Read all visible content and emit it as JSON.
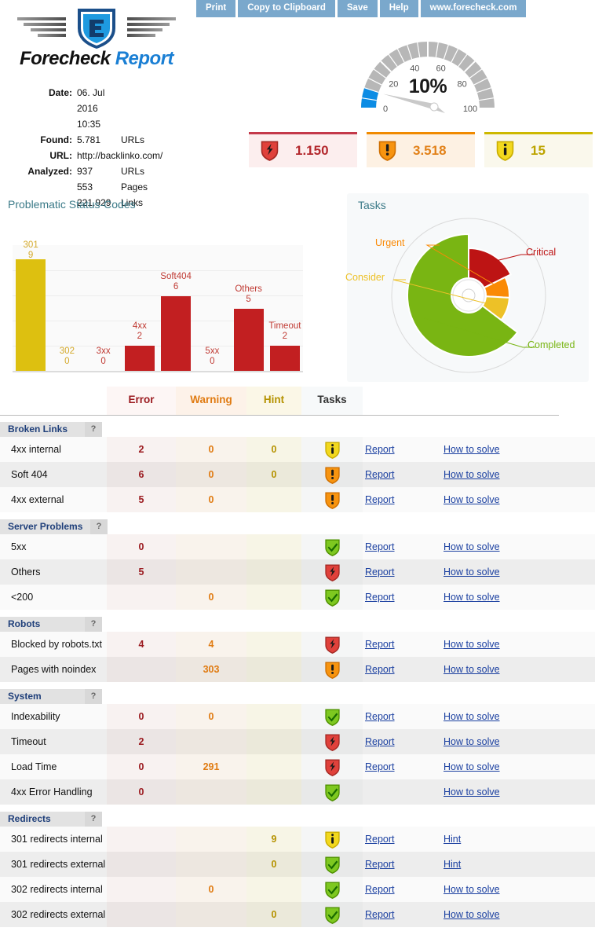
{
  "toolbar": {
    "buttons": [
      {
        "label": "Print",
        "name": "print-button"
      },
      {
        "label": "Copy to Clipboard",
        "name": "copy-to-clipboard-button"
      },
      {
        "label": "Save",
        "name": "save-button"
      },
      {
        "label": "Help",
        "name": "help-button"
      },
      {
        "label": "www.forecheck.com",
        "name": "website-link-button"
      }
    ]
  },
  "logo": {
    "brand": "Forecheck",
    "product": "Report"
  },
  "meta": {
    "rows": [
      {
        "label": "Date:",
        "value": "06. Jul 2016 10:35",
        "unit": ""
      },
      {
        "label": "Found:",
        "value": "5.781",
        "unit": "URLs"
      },
      {
        "label": "URL:",
        "value": "http://backlinko.com/",
        "unit": ""
      },
      {
        "label": "Analyzed:",
        "value": "937",
        "unit": "URLs"
      },
      {
        "label": "",
        "value": "553",
        "unit": "Pages"
      },
      {
        "label": "",
        "value": "221.929",
        "unit": "Links"
      }
    ]
  },
  "gauge": {
    "percent_label": "10%",
    "value": 10,
    "min": 0,
    "max": 100,
    "ticks": [
      "0",
      "20",
      "40",
      "60",
      "80",
      "100"
    ],
    "fill_color": "#0c8ce4",
    "track_color": "#b7b7b7"
  },
  "stats": [
    {
      "name": "critical-stat",
      "value": "1.150",
      "icon": "shield-critical-icon",
      "color": "#b3282d"
    },
    {
      "name": "warning-stat",
      "value": "3.518",
      "icon": "shield-warning-icon",
      "color": "#e2821a"
    },
    {
      "name": "hint-stat",
      "value": "15",
      "icon": "shield-hint-icon",
      "color": "#bda400"
    }
  ],
  "chart_data": [
    {
      "type": "bar",
      "title": "Problematic Status-Codes",
      "categories": [
        "301",
        "302",
        "3xx",
        "4xx",
        "Soft404",
        "5xx",
        "Others",
        "Timeout"
      ],
      "values": [
        9,
        0,
        0,
        2,
        6,
        0,
        5,
        2
      ],
      "colors": [
        "#ddc010",
        "#ddc010",
        "#c21f21",
        "#c21f21",
        "#c21f21",
        "#c21f21",
        "#c21f21",
        "#c21f21"
      ],
      "label_colors": [
        "#d4a92a",
        "#d4a92a",
        "#c03a33",
        "#c03a33",
        "#c03a33",
        "#c03a33",
        "#c03a33",
        "#c03a33"
      ],
      "xlabel": "",
      "ylabel": "",
      "ylim": [
        0,
        9
      ],
      "grid": true,
      "legend": false
    },
    {
      "type": "pie",
      "title": "Tasks",
      "categories": [
        "Critical",
        "Urgent",
        "Consider",
        "Completed"
      ],
      "values": [
        15,
        7,
        8,
        55
      ],
      "colors": [
        "#bd1414",
        "#fa8a05",
        "#edc127",
        "#79b513"
      ],
      "legend": "callout-labels"
    }
  ],
  "table": {
    "columns": [
      "Error",
      "Warning",
      "Hint",
      "Tasks"
    ],
    "help_label": "?",
    "sections": [
      {
        "title": "Broken Links",
        "rows": [
          {
            "name": "4xx internal",
            "error": "2",
            "warning": "0",
            "hint": "0",
            "task_icon": "shield-hint-icon",
            "report": "Report",
            "solve": "How to solve"
          },
          {
            "name": "Soft 404",
            "error": "6",
            "warning": "0",
            "hint": "0",
            "task_icon": "shield-warning-icon",
            "report": "Report",
            "solve": "How to solve"
          },
          {
            "name": "4xx external",
            "error": "5",
            "warning": "0",
            "hint": "",
            "task_icon": "shield-warning-icon",
            "report": "Report",
            "solve": "How to solve"
          }
        ]
      },
      {
        "title": "Server Problems",
        "rows": [
          {
            "name": "5xx",
            "error": "0",
            "warning": "",
            "hint": "",
            "task_icon": "shield-ok-icon",
            "report": "Report",
            "solve": "How to solve"
          },
          {
            "name": "Others",
            "error": "5",
            "warning": "",
            "hint": "",
            "task_icon": "shield-critical-icon",
            "report": "Report",
            "solve": "How to solve"
          },
          {
            "name": "<200",
            "error": "",
            "warning": "0",
            "hint": "",
            "task_icon": "shield-ok-icon",
            "report": "Report",
            "solve": "How to solve"
          }
        ]
      },
      {
        "title": "Robots",
        "rows": [
          {
            "name": "Blocked by robots.txt",
            "error": "4",
            "warning": "4",
            "hint": "",
            "task_icon": "shield-critical-icon",
            "report": "Report",
            "solve": "How to solve"
          },
          {
            "name": "Pages with noindex",
            "error": "",
            "warning": "303",
            "hint": "",
            "task_icon": "shield-warning-icon",
            "report": "Report",
            "solve": "How to solve"
          }
        ]
      },
      {
        "title": "System",
        "rows": [
          {
            "name": "Indexability",
            "error": "0",
            "warning": "0",
            "hint": "",
            "task_icon": "shield-ok-icon",
            "report": "Report",
            "solve": "How to solve"
          },
          {
            "name": "Timeout",
            "error": "2",
            "warning": "",
            "hint": "",
            "task_icon": "shield-critical-icon",
            "report": "Report",
            "solve": "How to solve"
          },
          {
            "name": "Load Time",
            "error": "0",
            "warning": "291",
            "hint": "",
            "task_icon": "shield-critical-icon",
            "report": "Report",
            "solve": "How to solve"
          },
          {
            "name": "4xx Error Handling",
            "error": "0",
            "warning": "",
            "hint": "",
            "task_icon": "shield-ok-icon",
            "report": "",
            "solve": "How to solve"
          }
        ]
      },
      {
        "title": "Redirects",
        "rows": [
          {
            "name": "301 redirects internal",
            "error": "",
            "warning": "",
            "hint": "9",
            "task_icon": "shield-hint-icon",
            "report": "Report",
            "solve": "Hint"
          },
          {
            "name": "301 redirects external",
            "error": "",
            "warning": "",
            "hint": "0",
            "task_icon": "shield-ok-icon",
            "report": "Report",
            "solve": "Hint"
          },
          {
            "name": "302 redirects internal",
            "error": "",
            "warning": "0",
            "hint": "",
            "task_icon": "shield-ok-icon",
            "report": "Report",
            "solve": "How to solve"
          },
          {
            "name": "302 redirects external",
            "error": "",
            "warning": "",
            "hint": "0",
            "task_icon": "shield-ok-icon",
            "report": "Report",
            "solve": "How to solve"
          }
        ]
      }
    ]
  }
}
